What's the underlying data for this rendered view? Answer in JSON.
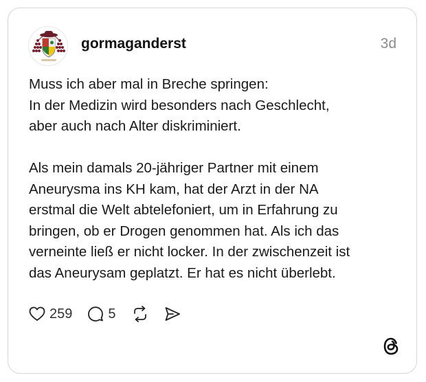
{
  "post": {
    "username": "gormaganderst",
    "timestamp": "3d",
    "text": "Muss ich aber mal in Breche springen:\nIn der Medizin wird besonders nach Geschlecht,\naber auch nach Alter diskriminiert.\n\nAls mein damals 20-jähriger Partner mit einem\nAneurysma ins KH kam, hat der Arzt in der NA\nerstmal die Welt abtelefoniert, um in Erfahrung zu\nbringen, ob er Drogen genommen hat. Als ich das\nverneinte ließ er nicht locker. In der zwischenzeit ist\ndas Aneurysam geplatzt. Er hat es nicht überlebt."
  },
  "actions": {
    "like_icon": "heart-icon",
    "like_count": "259",
    "reply_icon": "speech-bubble-icon",
    "reply_count": "5",
    "repost_icon": "repost-icon",
    "share_icon": "send-icon"
  },
  "branding": {
    "logo_icon": "threads-logo-icon"
  },
  "colors": {
    "text": "#1a1a1a",
    "muted": "#8a8a8a",
    "border": "#d6d6d6"
  }
}
